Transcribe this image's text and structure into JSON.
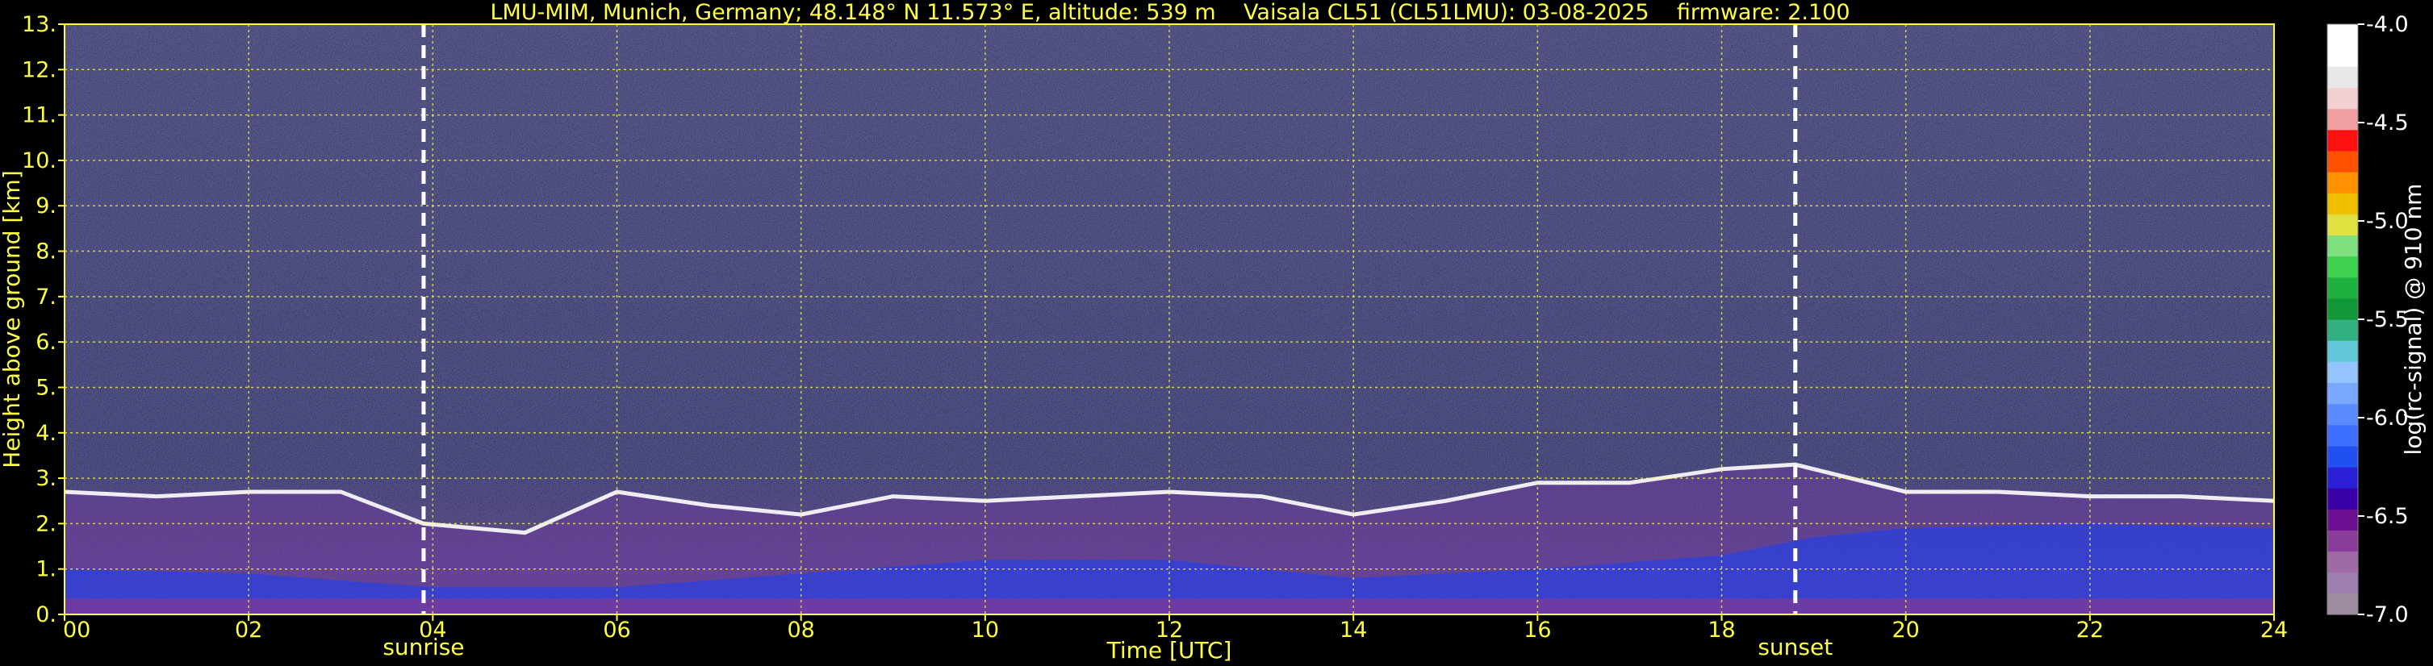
{
  "chart_data": {
    "type": "heatmap",
    "title": "LMU-MIM, Munich, Germany; 48.148° N 11.573° E, altitude: 539 m    Vaisala CL51 (CL51LMU): 03-08-2025    firmware: 2.100",
    "xlabel": "Time [UTC]",
    "ylabel": "Height above ground [km]",
    "xlim": [
      0,
      24
    ],
    "ylim": [
      0,
      13
    ],
    "x_ticks": [
      "00",
      "02",
      "04",
      "06",
      "08",
      "10",
      "12",
      "14",
      "16",
      "18",
      "20",
      "22",
      "24"
    ],
    "y_ticks": [
      "0.",
      "1.",
      "2.",
      "3.",
      "4.",
      "5.",
      "6.",
      "7.",
      "8.",
      "9.",
      "10.",
      "11.",
      "12.",
      "13."
    ],
    "grid": true,
    "annotations": [
      {
        "label": "sunrise",
        "time": 3.9
      },
      {
        "label": "sunset",
        "time": 18.8
      }
    ],
    "colorbar": {
      "label": "log(rc-signal) @ 910 nm",
      "range": [
        -7.0,
        -4.0
      ],
      "ticks": [
        "-4.0",
        "-4.5",
        "-5.0",
        "-5.5",
        "-6.0",
        "-6.5",
        "-7.0"
      ],
      "colors": [
        "#a08ca0",
        "#9d7faf",
        "#a06aa6",
        "#8a3c9a",
        "#6a1090",
        "#3a00a8",
        "#2a20d8",
        "#2050f0",
        "#3c6eff",
        "#5a8cff",
        "#78a8ff",
        "#94c4ff",
        "#60c8d8",
        "#30b080",
        "#109838",
        "#20b040",
        "#40d050",
        "#80e080",
        "#e0e040",
        "#f0c000",
        "#ff9000",
        "#ff5000",
        "#ff1010",
        "#f0a0a0",
        "#f0d0d0",
        "#e8e8e8",
        "#ffffff",
        "#ffffff"
      ]
    },
    "layers": {
      "boundary_layer_top_km": [
        [
          0,
          2.7
        ],
        [
          1,
          2.6
        ],
        [
          2,
          2.7
        ],
        [
          3,
          2.7
        ],
        [
          3.9,
          2.0
        ],
        [
          5,
          1.8
        ],
        [
          6,
          2.7
        ],
        [
          7,
          2.4
        ],
        [
          8,
          2.2
        ],
        [
          9,
          2.6
        ],
        [
          10,
          2.5
        ],
        [
          11,
          2.6
        ],
        [
          12,
          2.7
        ],
        [
          13,
          2.6
        ],
        [
          14,
          2.2
        ],
        [
          15,
          2.5
        ],
        [
          16,
          2.9
        ],
        [
          17,
          2.9
        ],
        [
          18,
          3.2
        ],
        [
          18.8,
          3.3
        ],
        [
          20,
          2.7
        ],
        [
          21,
          2.7
        ],
        [
          22,
          2.6
        ],
        [
          23,
          2.6
        ],
        [
          24,
          2.5
        ]
      ],
      "nocturnal_layer_top_km": [
        [
          0,
          1.0
        ],
        [
          2,
          0.9
        ],
        [
          4,
          0.6
        ],
        [
          6,
          0.6
        ],
        [
          8,
          0.9
        ],
        [
          10,
          1.2
        ],
        [
          12,
          1.2
        ],
        [
          14,
          0.8
        ],
        [
          16,
          1.0
        ],
        [
          18,
          1.3
        ],
        [
          19,
          1.7
        ],
        [
          20,
          1.9
        ],
        [
          22,
          2.0
        ],
        [
          24,
          1.9
        ]
      ]
    }
  }
}
